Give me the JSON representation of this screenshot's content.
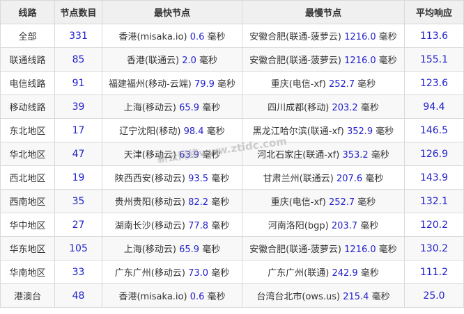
{
  "table": {
    "headers": [
      "线路",
      "节点数目",
      "最快节点",
      "最慢节点",
      "平均响应"
    ],
    "unit": "毫秒",
    "rows": [
      {
        "line": "全部",
        "count": "331",
        "fast_node": "香港(misaka.io)",
        "fast_ms": "0.6",
        "slow_node": "安徽合肥(联通-菠萝云)",
        "slow_ms": "1216.0",
        "avg": "113.6"
      },
      {
        "line": "联通线路",
        "count": "85",
        "fast_node": "香港(联通云)",
        "fast_ms": "2.0",
        "slow_node": "安徽合肥(联通-菠萝云)",
        "slow_ms": "1216.0",
        "avg": "155.1"
      },
      {
        "line": "电信线路",
        "count": "91",
        "fast_node": "福建福州(移动-云端)",
        "fast_ms": "79.9",
        "slow_node": "重庆(电信-xf)",
        "slow_ms": "252.7",
        "avg": "123.6"
      },
      {
        "line": "移动线路",
        "count": "39",
        "fast_node": "上海(移动云)",
        "fast_ms": "65.9",
        "slow_node": "四川成都(移动)",
        "slow_ms": "203.2",
        "avg": "94.4"
      },
      {
        "line": "东北地区",
        "count": "17",
        "fast_node": "辽宁沈阳(移动)",
        "fast_ms": "98.4",
        "slow_node": "黑龙江哈尔滨(联通-xf)",
        "slow_ms": "352.9",
        "avg": "146.5"
      },
      {
        "line": "华北地区",
        "count": "47",
        "fast_node": "天津(移动云)",
        "fast_ms": "63.9",
        "slow_node": "河北石家庄(联通-xf)",
        "slow_ms": "353.2",
        "avg": "126.9"
      },
      {
        "line": "西北地区",
        "count": "19",
        "fast_node": "陕西西安(移动云)",
        "fast_ms": "93.5",
        "slow_node": "甘肃兰州(联通云)",
        "slow_ms": "207.6",
        "avg": "143.9"
      },
      {
        "line": "西南地区",
        "count": "35",
        "fast_node": "贵州贵阳(移动云)",
        "fast_ms": "82.2",
        "slow_node": "重庆(电信-xf)",
        "slow_ms": "252.7",
        "avg": "132.1"
      },
      {
        "line": "华中地区",
        "count": "27",
        "fast_node": "湖南长沙(移动云)",
        "fast_ms": "77.8",
        "slow_node": "河南洛阳(bgp)",
        "slow_ms": "203.7",
        "avg": "120.2"
      },
      {
        "line": "华东地区",
        "count": "105",
        "fast_node": "上海(移动云)",
        "fast_ms": "65.9",
        "slow_node": "安徽合肥(联通-菠萝云)",
        "slow_ms": "1216.0",
        "avg": "130.2"
      },
      {
        "line": "华南地区",
        "count": "33",
        "fast_node": "广东广州(移动云)",
        "fast_ms": "73.0",
        "slow_node": "广东广州(联通)",
        "slow_ms": "242.9",
        "avg": "111.2"
      },
      {
        "line": "港澳台",
        "count": "48",
        "fast_node": "香港(misaka.io)",
        "fast_ms": "0.6",
        "slow_node": "台湾台北市(ows.us)",
        "slow_ms": "215.4",
        "avg": "25.0"
      }
    ]
  },
  "watermark": "新云网络www.ztidc.com"
}
